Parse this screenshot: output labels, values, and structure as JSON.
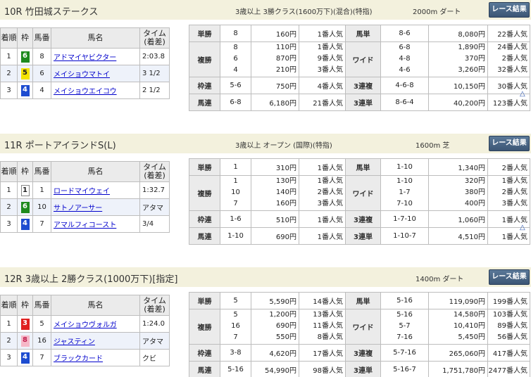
{
  "button_label": "レース結果",
  "results_headers": [
    "着順",
    "枠",
    "馬番",
    "馬名",
    "タイム",
    "(着差)"
  ],
  "payout_labels": {
    "tansho": "単勝",
    "fukusho": "複勝",
    "wakuren": "枠連",
    "umaren": "馬連",
    "umatan": "馬単",
    "wide": "ワイド",
    "sanrenpuku": "3連複",
    "sanrentan": "3連単"
  },
  "colors": {
    "header_bg": "#f3f1dd",
    "link": "#0000cc",
    "button": "#4a6685"
  },
  "races": [
    {
      "title": "10R 竹田城ステークス",
      "conditions": "3歳以上 3勝クラス(1600万下)(混合)(特指)",
      "distance": "2000m ダート",
      "rows": [
        {
          "pos": "1",
          "waku": "6",
          "uma": "8",
          "name": "アドマイヤビクター",
          "time": "2:03.8"
        },
        {
          "pos": "2",
          "waku": "5",
          "uma": "6",
          "name": "メイショウマトイ",
          "time": "3 1/2"
        },
        {
          "pos": "3",
          "waku": "4",
          "uma": "4",
          "name": "メイショウエイコウ",
          "time": "2 1/2"
        }
      ],
      "tansho": {
        "combo": "8",
        "amount": "160円",
        "pop": "1番人気"
      },
      "fukusho": [
        {
          "combo": "8",
          "amount": "110円",
          "pop": "1番人気"
        },
        {
          "combo": "6",
          "amount": "870円",
          "pop": "9番人気"
        },
        {
          "combo": "4",
          "amount": "210円",
          "pop": "3番人気"
        }
      ],
      "wakuren": {
        "combo": "5-6",
        "amount": "750円",
        "pop": "4番人気"
      },
      "umaren": {
        "combo": "6-8",
        "amount": "6,180円",
        "pop": "21番人気"
      },
      "umatan": {
        "combo": "8-6",
        "amount": "8,080円",
        "pop": "22番人気"
      },
      "wide": [
        {
          "combo": "6-8",
          "amount": "1,890円",
          "pop": "24番人気"
        },
        {
          "combo": "4-8",
          "amount": "370円",
          "pop": "2番人気"
        },
        {
          "combo": "4-6",
          "amount": "3,260円",
          "pop": "32番人気"
        }
      ],
      "sanrenpuku": {
        "combo": "4-6-8",
        "amount": "10,150円",
        "pop": "30番人気"
      },
      "sanrentan": {
        "combo": "8-6-4",
        "amount": "40,200円",
        "pop": "123番人気"
      }
    },
    {
      "title": "11R ポートアイランドS(L)",
      "conditions": "3歳以上 オープン (国際)(特指)",
      "distance": "1600m 芝",
      "rows": [
        {
          "pos": "1",
          "waku": "1",
          "uma": "1",
          "name": "ロードマイウェイ",
          "time": "1:32.7"
        },
        {
          "pos": "2",
          "waku": "6",
          "uma": "10",
          "name": "サトノアーサー",
          "time": "アタマ"
        },
        {
          "pos": "3",
          "waku": "4",
          "uma": "7",
          "name": "アマルフィコースト",
          "time": "3/4"
        }
      ],
      "tansho": {
        "combo": "1",
        "amount": "310円",
        "pop": "1番人気"
      },
      "fukusho": [
        {
          "combo": "1",
          "amount": "130円",
          "pop": "1番人気"
        },
        {
          "combo": "10",
          "amount": "140円",
          "pop": "2番人気"
        },
        {
          "combo": "7",
          "amount": "160円",
          "pop": "3番人気"
        }
      ],
      "wakuren": {
        "combo": "1-6",
        "amount": "510円",
        "pop": "1番人気"
      },
      "umaren": {
        "combo": "1-10",
        "amount": "690円",
        "pop": "1番人気"
      },
      "umatan": {
        "combo": "1-10",
        "amount": "1,340円",
        "pop": "2番人気"
      },
      "wide": [
        {
          "combo": "1-10",
          "amount": "320円",
          "pop": "1番人気"
        },
        {
          "combo": "1-7",
          "amount": "380円",
          "pop": "2番人気"
        },
        {
          "combo": "7-10",
          "amount": "400円",
          "pop": "3番人気"
        }
      ],
      "sanrenpuku": {
        "combo": "1-7-10",
        "amount": "1,060円",
        "pop": "1番人気"
      },
      "sanrentan": {
        "combo": "1-10-7",
        "amount": "4,510円",
        "pop": "1番人気"
      }
    },
    {
      "title": "12R 3歳以上 2勝クラス(1000万下)[指定]",
      "conditions": "",
      "distance": "1400m ダート",
      "rows": [
        {
          "pos": "1",
          "waku": "3",
          "uma": "5",
          "name": "メイショウヴォルガ",
          "time": "1:24.0"
        },
        {
          "pos": "2",
          "waku": "8",
          "uma": "16",
          "name": "ジャスティン",
          "time": "アタマ"
        },
        {
          "pos": "3",
          "waku": "4",
          "uma": "7",
          "name": "ブラックカード",
          "time": "クビ"
        }
      ],
      "tansho": {
        "combo": "5",
        "amount": "5,590円",
        "pop": "14番人気"
      },
      "fukusho": [
        {
          "combo": "5",
          "amount": "1,200円",
          "pop": "13番人気"
        },
        {
          "combo": "16",
          "amount": "690円",
          "pop": "11番人気"
        },
        {
          "combo": "7",
          "amount": "550円",
          "pop": "8番人気"
        }
      ],
      "wakuren": {
        "combo": "3-8",
        "amount": "4,620円",
        "pop": "17番人気"
      },
      "umaren": {
        "combo": "5-16",
        "amount": "54,990円",
        "pop": "98番人気"
      },
      "umatan": {
        "combo": "5-16",
        "amount": "119,090円",
        "pop": "199番人気"
      },
      "wide": [
        {
          "combo": "5-16",
          "amount": "14,580円",
          "pop": "103番人気"
        },
        {
          "combo": "5-7",
          "amount": "10,410円",
          "pop": "89番人気"
        },
        {
          "combo": "7-16",
          "amount": "5,450円",
          "pop": "56番人気"
        }
      ],
      "sanrenpuku": {
        "combo": "5-7-16",
        "amount": "265,060円",
        "pop": "417番人気"
      },
      "sanrentan": {
        "combo": "5-16-7",
        "amount": "1,751,780円",
        "pop": "2477番人気"
      }
    }
  ]
}
